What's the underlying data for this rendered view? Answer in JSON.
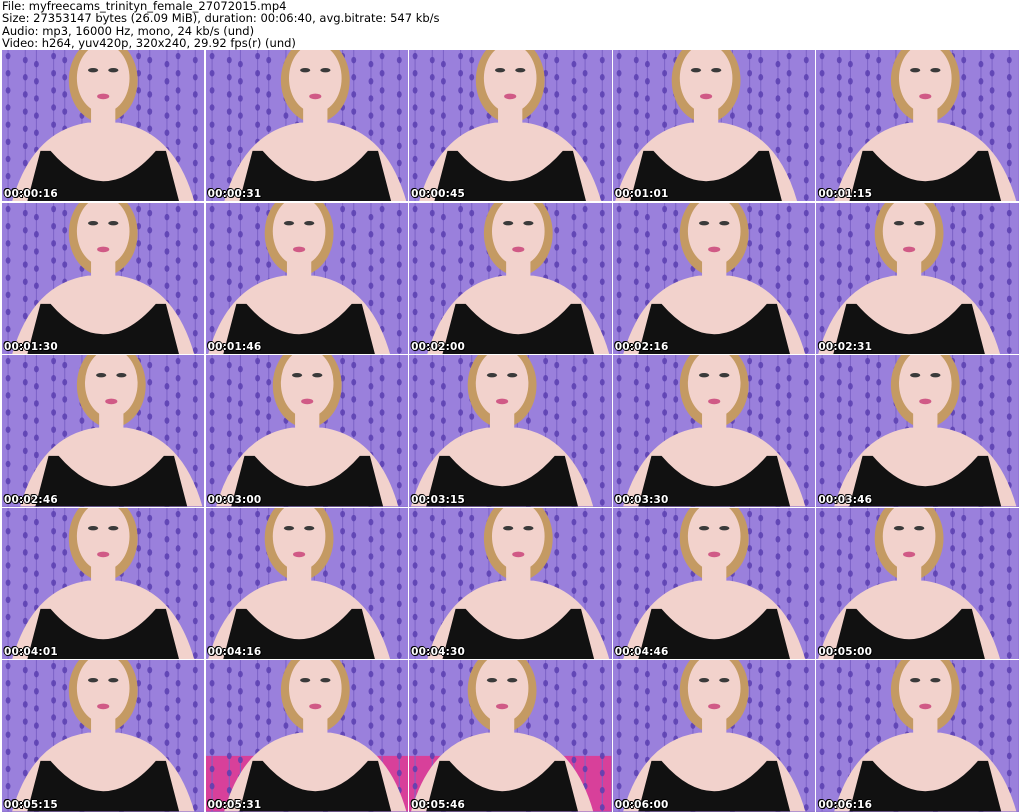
{
  "header": {
    "file_line": "File: myfreecams_trinityn_female_27072015.mp4",
    "size_line": "Size: 27353147 bytes (26.09 MiB), duration: 00:06:40, avg.bitrate: 547 kb/s",
    "audio_line": "Audio: mp3, 16000 Hz, mono, 24 kb/s (und)",
    "video_line": "Video: h264, yuv420p, 320x240, 29.92 fps(r) (und)"
  },
  "thumbnails": [
    {
      "timestamp": "00:00:16",
      "variant": "a",
      "bg": "purple"
    },
    {
      "timestamp": "00:00:31",
      "variant": "b",
      "bg": "purple"
    },
    {
      "timestamp": "00:00:45",
      "variant": "a",
      "bg": "purple"
    },
    {
      "timestamp": "00:01:01",
      "variant": "c",
      "bg": "purple"
    },
    {
      "timestamp": "00:01:15",
      "variant": "b",
      "bg": "purple"
    },
    {
      "timestamp": "00:01:30",
      "variant": "a",
      "bg": "purple"
    },
    {
      "timestamp": "00:01:46",
      "variant": "c",
      "bg": "purple"
    },
    {
      "timestamp": "00:02:00",
      "variant": "b",
      "bg": "purple"
    },
    {
      "timestamp": "00:02:16",
      "variant": "a",
      "bg": "purple"
    },
    {
      "timestamp": "00:02:31",
      "variant": "c",
      "bg": "purple"
    },
    {
      "timestamp": "00:02:46",
      "variant": "b",
      "bg": "purple"
    },
    {
      "timestamp": "00:03:00",
      "variant": "a",
      "bg": "purple"
    },
    {
      "timestamp": "00:03:15",
      "variant": "c",
      "bg": "purple"
    },
    {
      "timestamp": "00:03:30",
      "variant": "a",
      "bg": "purple"
    },
    {
      "timestamp": "00:03:46",
      "variant": "b",
      "bg": "purple"
    },
    {
      "timestamp": "00:04:01",
      "variant": "a",
      "bg": "purple"
    },
    {
      "timestamp": "00:04:16",
      "variant": "c",
      "bg": "purple"
    },
    {
      "timestamp": "00:04:30",
      "variant": "b",
      "bg": "purple"
    },
    {
      "timestamp": "00:04:46",
      "variant": "a",
      "bg": "purple"
    },
    {
      "timestamp": "00:05:00",
      "variant": "c",
      "bg": "purple"
    },
    {
      "timestamp": "00:05:15",
      "variant": "a",
      "bg": "purple"
    },
    {
      "timestamp": "00:05:31",
      "variant": "b",
      "bg": "pink"
    },
    {
      "timestamp": "00:05:46",
      "variant": "c",
      "bg": "pink"
    },
    {
      "timestamp": "00:06:00",
      "variant": "a",
      "bg": "purple"
    },
    {
      "timestamp": "00:06:16",
      "variant": "b",
      "bg": "purple"
    }
  ],
  "colors": {
    "bg_purple": "#9a80dc",
    "bg_pink": "#d8409a",
    "bead": "#5a3fb0",
    "skin": "#f2d2cc",
    "hair": "#c49a63",
    "top": "#111111"
  }
}
